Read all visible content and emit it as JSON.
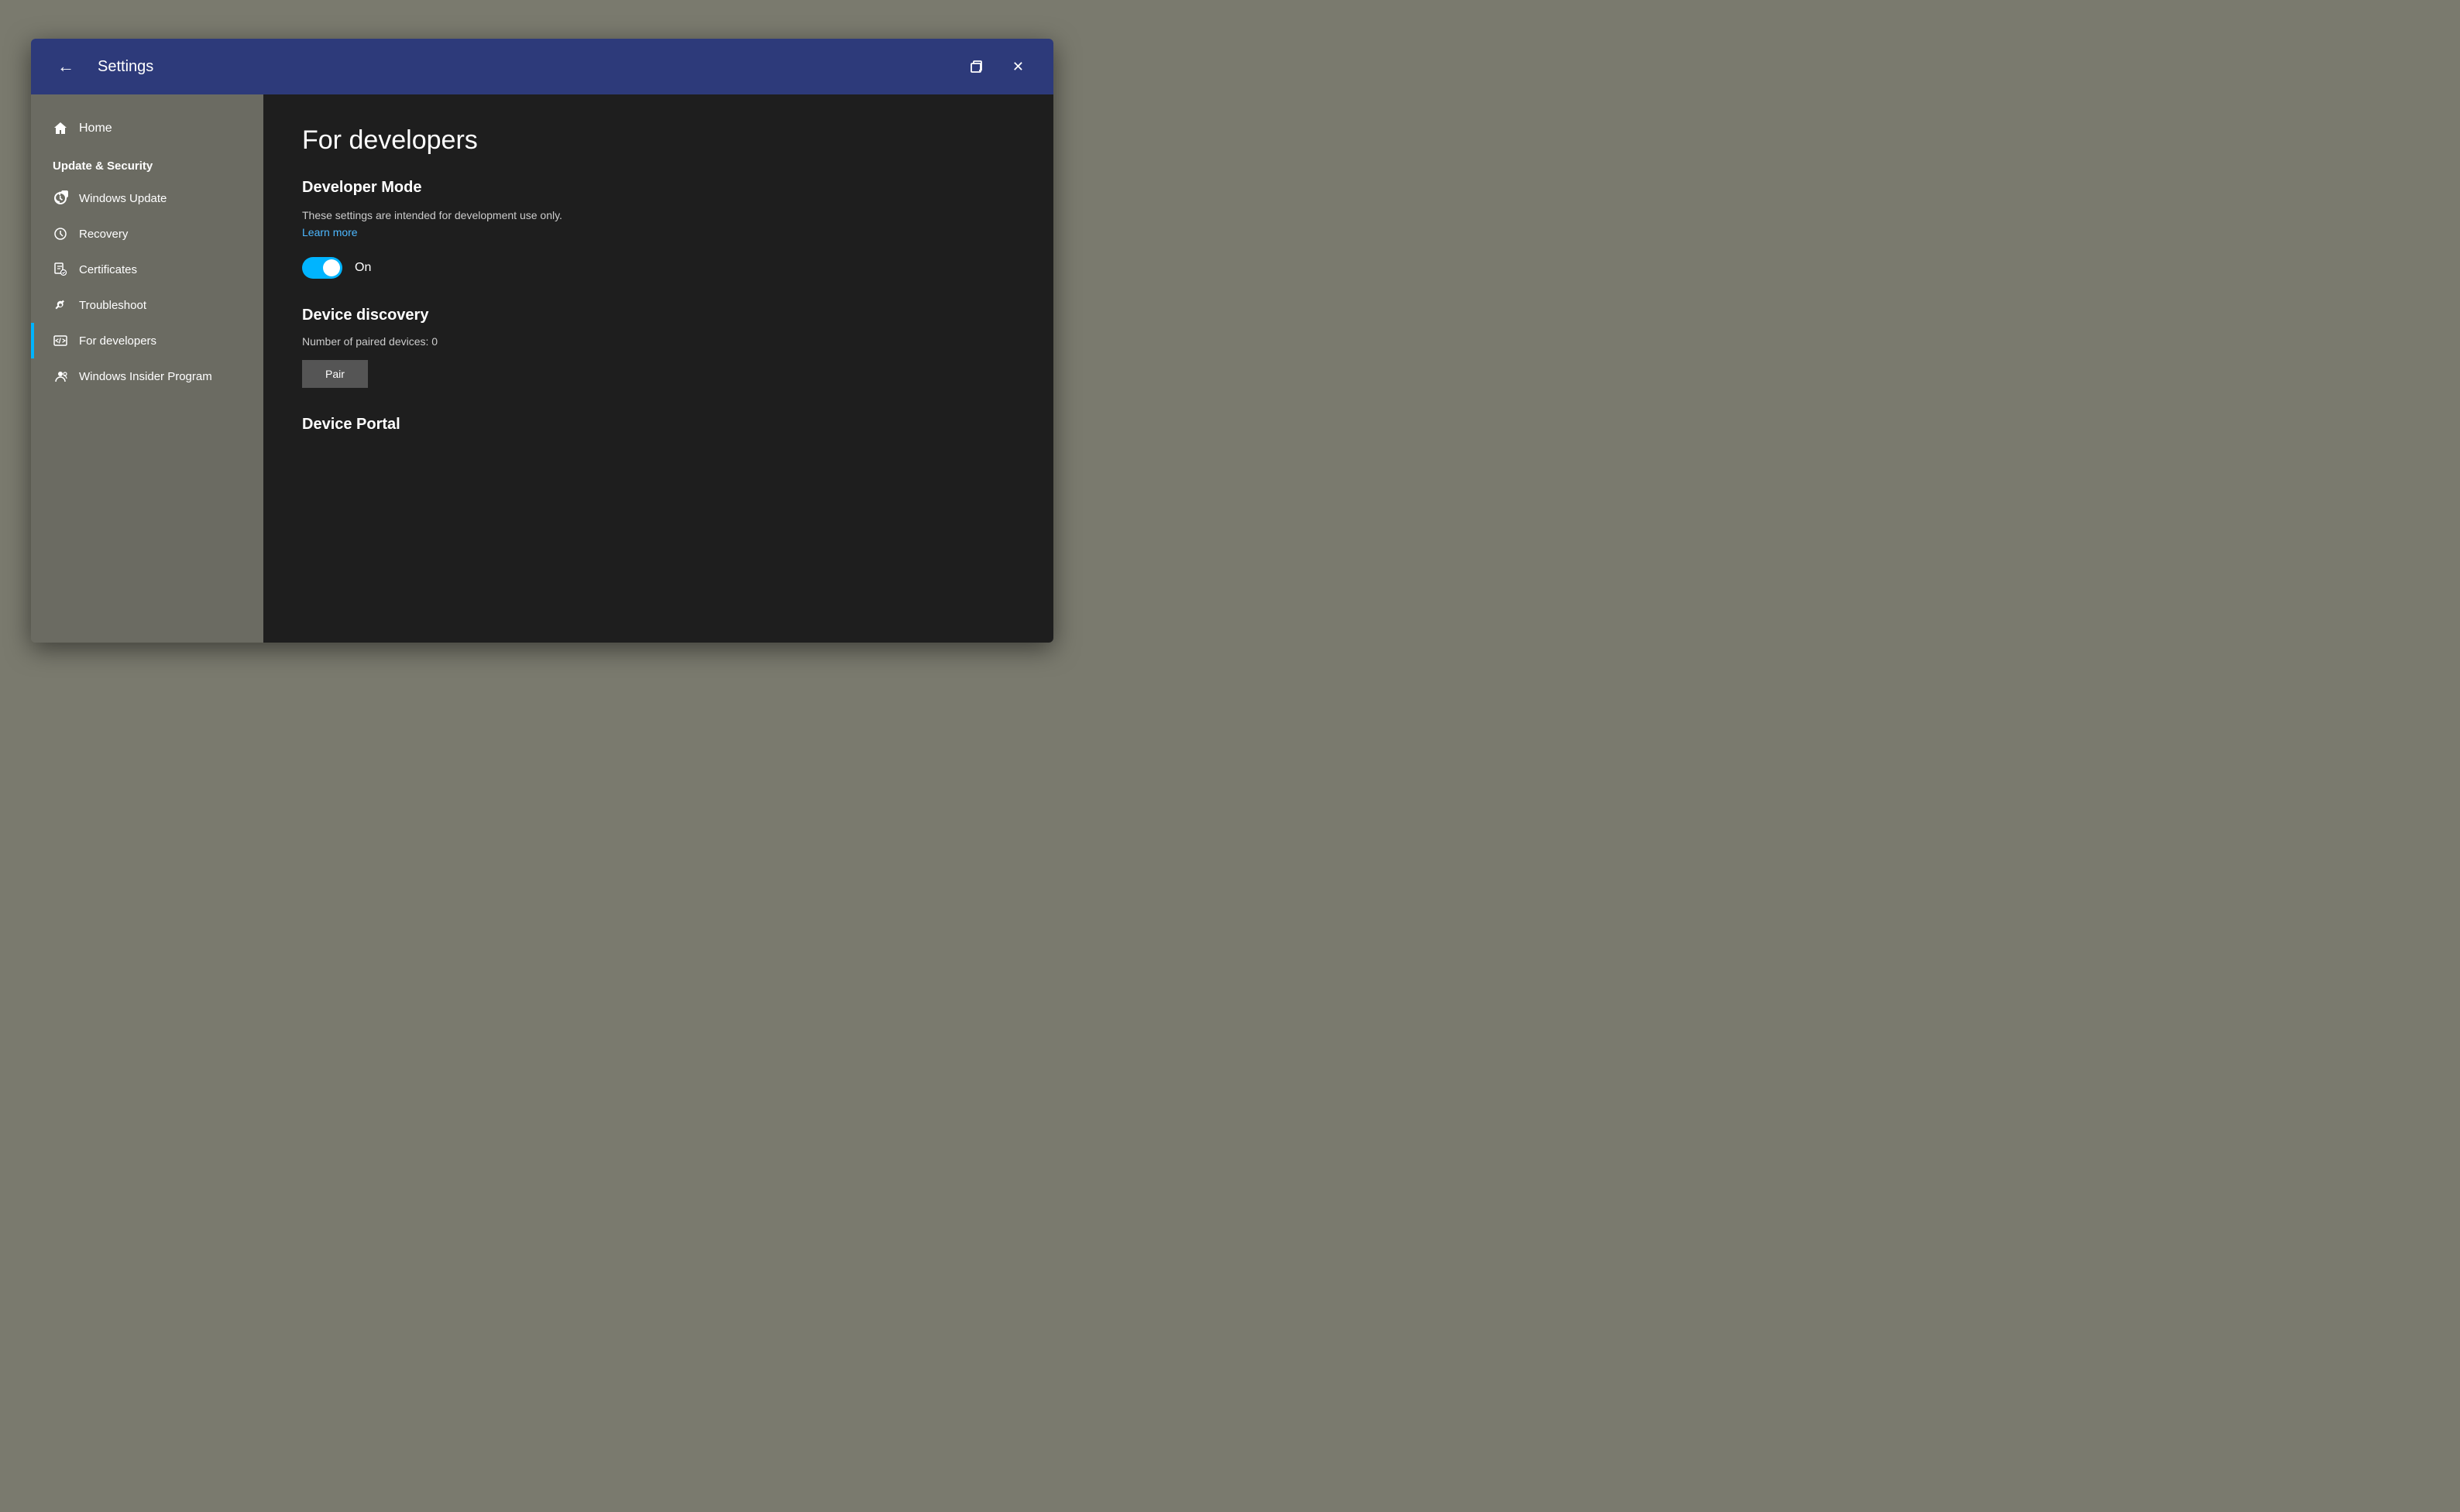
{
  "window": {
    "title": "Settings",
    "back_label": "←",
    "close_label": "✕"
  },
  "sidebar": {
    "home_label": "Home",
    "section_label": "Update & Security",
    "items": [
      {
        "id": "windows-update",
        "label": "Windows Update",
        "icon": "update",
        "active": false
      },
      {
        "id": "recovery",
        "label": "Recovery",
        "icon": "recovery",
        "active": false
      },
      {
        "id": "certificates",
        "label": "Certificates",
        "icon": "cert",
        "active": false
      },
      {
        "id": "troubleshoot",
        "label": "Troubleshoot",
        "icon": "trouble",
        "active": false
      },
      {
        "id": "for-developers",
        "label": "For developers",
        "icon": "dev",
        "active": true
      },
      {
        "id": "windows-insider",
        "label": "Windows Insider Program",
        "icon": "insider",
        "active": false
      }
    ]
  },
  "main": {
    "page_title": "For developers",
    "developer_mode_section": "Developer Mode",
    "description": "These settings are intended for development use only.",
    "learn_more": "Learn more",
    "toggle_state": "On",
    "device_discovery_section": "Device discovery",
    "paired_devices_text": "Number of paired devices: 0",
    "pair_button_label": "Pair",
    "device_portal_section": "Device Portal"
  }
}
